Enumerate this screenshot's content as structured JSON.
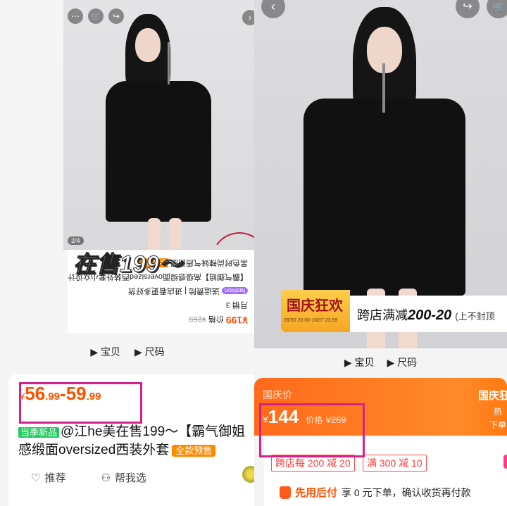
{
  "left": {
    "photo_counter": "2/4",
    "overlay_text": "在售199～",
    "upside_card": {
      "price": "¥199",
      "price_label": "价格",
      "price_was": "¥269",
      "sales": "月销 3",
      "shop_tag": "fashion",
      "shop_text": "送运费险 | 进店看更多好货",
      "title_1": "【霸气御姐】高级感缎面oversized西装外套小众设计",
      "title_2": "黑色时尚辣妹气质西服",
      "tag": "全款预售"
    },
    "tabs": [
      "宝贝",
      "尺码"
    ],
    "price": {
      "yen": "¥",
      "min_int": "56",
      "min_dec": ".99",
      "dash": "-",
      "max_int": "59",
      "max_dec": ".99"
    },
    "title": {
      "new_tag": "当季新品",
      "line1": "@江he美在售199～【霸气御姐",
      "line2": "感缎面oversized西装外套",
      "presale_tag": "全款预售"
    },
    "actions": {
      "recommend": "推荐",
      "help_choose": "帮我选"
    }
  },
  "right": {
    "promo": {
      "badge_title": "国庆狂欢",
      "badge_date": "09/30 20:00-10/07 23:59",
      "text_prefix": "跨店满减",
      "text_bold": "200-20",
      "text_suffix": "(上不封顶"
    },
    "tabs": [
      "宝贝",
      "尺码"
    ],
    "price_bar": {
      "label": "国庆价",
      "yen": "¥",
      "price": "144",
      "was_label": "价格",
      "was_price": "¥269",
      "side_title": "国庆狂",
      "side_line2": "热",
      "side_line3": "下单"
    },
    "coupons": [
      "跨店每 200 减 20",
      "满 300 减 10"
    ],
    "pay": {
      "title": "先用后付",
      "text": "享 0 元下单，确认收货再付款"
    }
  }
}
